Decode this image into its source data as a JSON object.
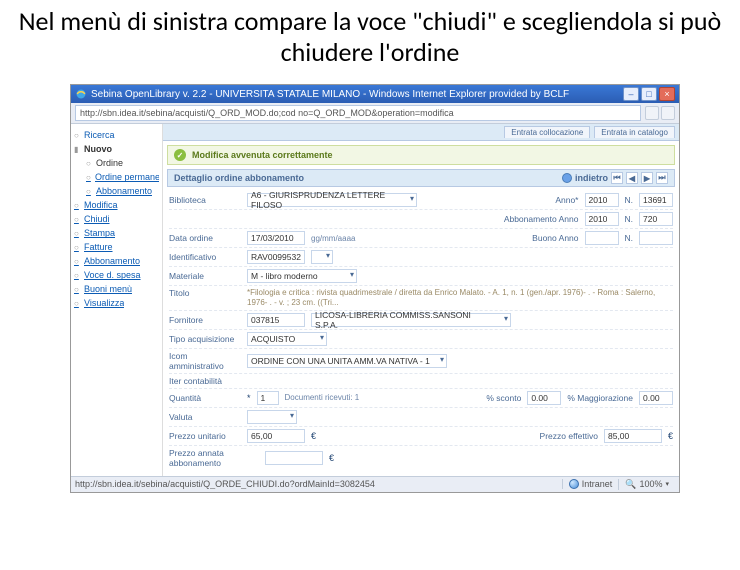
{
  "slide": {
    "title": "Nel menù di sinistra compare la voce \"chiudi\" e scegliendola si può chiudere l'ordine"
  },
  "window": {
    "title": "Sebina OpenLibrary v. 2.2 - UNIVERSITA STATALE MILANO - Windows Internet Explorer provided by BCLF",
    "address": "http://sbn.idea.it/sebina/acquisti/Q_ORD_MOD.do;cod no=Q_ORD_MOD&operation=modifica"
  },
  "tabs": {
    "coll": "Entrata collocazione",
    "inc": "Entrata in catalogo"
  },
  "sidebar": {
    "items": [
      {
        "label": "Ricerca",
        "type": "bullet"
      },
      {
        "label": "Nuovo",
        "type": "bold"
      },
      {
        "label": "Ordine",
        "type": "sub"
      },
      {
        "label": "Ordine permanente",
        "type": "link-sub"
      },
      {
        "label": "Abbonamento",
        "type": "link-sub"
      },
      {
        "label": "Modifica",
        "type": "link"
      },
      {
        "label": "Chiudi",
        "type": "link"
      },
      {
        "label": "Stampa",
        "type": "link"
      },
      {
        "label": "Fatture",
        "type": "link"
      },
      {
        "label": "Abbonamento",
        "type": "link"
      },
      {
        "label": "Voce d. spesa",
        "type": "link"
      },
      {
        "label": "Buoni menù",
        "type": "link"
      },
      {
        "label": "Visualizza",
        "type": "link"
      }
    ]
  },
  "message": {
    "text": "Modifica avvenuta correttamente"
  },
  "section": {
    "title": "Dettaglio ordine abbonamento",
    "back": "indietro"
  },
  "form": {
    "biblioteca_label": "Biblioteca",
    "biblioteca": "A6 - GIURISPRUDENZA LETTERE FILOSO",
    "anno_label": "Anno*",
    "anno": "2010",
    "n_label": "N.",
    "n": "13691",
    "abb_anno_label": "Abbonamento Anno",
    "abb_anno": "2010",
    "abb_n": "720",
    "data_label": "Data ordine",
    "data": "17/03/2010",
    "data_fmt": "gg/mm/aaaa",
    "buono_label": "Buono Anno",
    "ident_label": "Identificativo",
    "ident": "RAV0099532",
    "mat_label": "Materiale",
    "mat": "M - libro moderno",
    "titolo_label": "Titolo",
    "titolo": "*Filologia e critica : rivista quadrimestrale / diretta da Enrico Malato. - A. 1, n. 1 (gen./apr. 1976)-    . - Roma : Salerno, 1976-    . - v. ; 23 cm. ((Tri...",
    "forn_label": "Fornitore",
    "forn_code": "037815",
    "forn_name": "LICOSA-LIBRERIA COMMISS.SANSONI S.P.A.",
    "tipo_label": "Tipo acquisizione",
    "tipo": "ACQUISTO",
    "amm_label": "Icom amministrativo",
    "amm": "ORDINE CON UNA UNITA AMM.VA NATIVA - 1",
    "cont_label": "Iter contabilità",
    "quant_label": "Quantità",
    "quant_star": "*",
    "quant": "1",
    "doc_ric": "Documenti ricevuti: 1",
    "sconto_label": "% sconto",
    "sconto": "0.00",
    "magg_label": "% Maggiorazione",
    "magg": "0.00",
    "val_label": "Valuta",
    "prezzo_label": "Prezzo unitario",
    "prezzo": "65,00",
    "eur": "€",
    "prezzo_eff_label": "Prezzo effettivo",
    "prezzo_eff": "85,00",
    "abb_annata_label": "Prezzo annata abbonamento"
  },
  "status": {
    "url": "http://sbn.idea.it/sebina/acquisti/Q_ORDE_CHIUDI.do?ordMainId=3082454",
    "zone": "Intranet",
    "zoom": "100%"
  }
}
